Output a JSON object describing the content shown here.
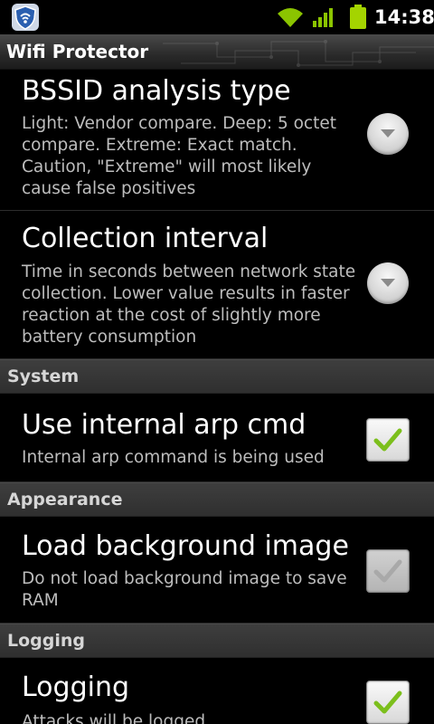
{
  "status_bar": {
    "time": "14:38",
    "icons": [
      "app-shield-icon",
      "wifi-icon",
      "signal-icon",
      "battery-charging-icon"
    ]
  },
  "app": {
    "title": "Wifi Protector"
  },
  "preferences": [
    {
      "title": "BSSID analysis type",
      "summary": "Light: Vendor compare. Deep: 5 octet compare. Extreme: Exact match. Caution, \"Extreme\" will most likely cause false positives",
      "widget": "dropdown"
    },
    {
      "title": "Collection interval",
      "summary": "Time in seconds between network state collection. Lower value results in faster reaction at the cost of slightly more battery consumption",
      "widget": "dropdown"
    }
  ],
  "categories": {
    "system": "System",
    "appearance": "Appearance",
    "logging": "Logging"
  },
  "system": {
    "arp": {
      "title": "Use internal arp cmd",
      "summary": "Internal arp command is being used",
      "checked": true
    }
  },
  "appearance": {
    "background": {
      "title": "Load background image",
      "summary": "Do not load background image to save RAM",
      "checked": false
    }
  },
  "logging": {
    "logging": {
      "title": "Logging",
      "summary": "Attacks will be logged",
      "checked": true
    }
  },
  "colors": {
    "check_green": "#7cbf1c",
    "battery_green": "#a4d400",
    "category_bg": "#353535"
  }
}
